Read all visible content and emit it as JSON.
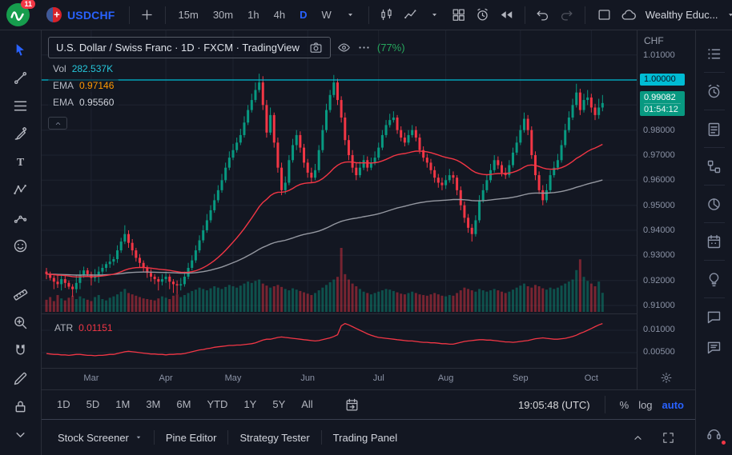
{
  "topbar": {
    "logo_badge": "11",
    "symbol": "USDCHF",
    "timeframes": [
      "15m",
      "30m",
      "1h",
      "4h",
      "D",
      "W"
    ],
    "active_timeframe": "D",
    "account": "Wealthy Educ...",
    "tool_icons": [
      "add-symbol-icon",
      "chart-style-candles-icon",
      "indicators-icon",
      "layout-templates-icon",
      "alert-icon",
      "bar-replay-icon",
      "undo-icon",
      "redo-icon",
      "select-layout-icon",
      "cloud-sync-icon",
      "caret-down-icon"
    ]
  },
  "left_toolbar": [
    "cursor-icon",
    "trend-line-icon",
    "fib-retracement-icon",
    "brush-icon",
    "text-tool-icon",
    "xabcd-pattern-icon",
    "forecast-icon",
    "emoji-icon",
    "ruler-icon",
    "zoom-in-icon",
    "magnet-icon",
    "draw-edit-icon",
    "lock-all-icon",
    "hide-drawings-icon"
  ],
  "right_sidebar": [
    "watchlist-icon",
    "alerts-icon",
    "news-icon",
    "data-window-icon",
    "hotlists-icon",
    "calendar-icon",
    "ideas-icon",
    "chat-icon",
    "streams-icon",
    "help-icon"
  ],
  "legend": {
    "title": "U.S. Dollar / Swiss Franc · 1D · FXCM · TradingView",
    "extra": "(77%)",
    "vol_label": "Vol",
    "vol_value": "282.537K",
    "ema1_label": "EMA",
    "ema1_value": "0.97146",
    "ema2_label": "EMA",
    "ema2_value": "0.95560"
  },
  "atr_pane": {
    "label": "ATR",
    "value": "0.01151",
    "tick_labels": [
      "0.01000",
      "0.00500"
    ]
  },
  "price_axis": {
    "currency": "CHF",
    "tick_labels": [
      "1.01000",
      "1.00000",
      "0.99000",
      "0.98000",
      "0.97000",
      "0.96000",
      "0.95000",
      "0.94000",
      "0.93000",
      "0.92000",
      "0.91000"
    ],
    "line_badge": "1.00000",
    "last_price_label": "0.99082",
    "countdown": "01:54:12"
  },
  "range_bar": {
    "ranges": [
      "1D",
      "5D",
      "1M",
      "3M",
      "6M",
      "YTD",
      "1Y",
      "5Y",
      "All"
    ],
    "clock": "19:05:48 (UTC)",
    "percent_label": "%",
    "log_label": "log",
    "auto_label": "auto"
  },
  "tabs_bar": {
    "tabs": [
      "Stock Screener",
      "Pine Editor",
      "Strategy Tester",
      "Trading Panel"
    ]
  },
  "colors": {
    "up": "#089981",
    "down": "#f23645",
    "volume_up": "rgba(8,153,129,0.45)",
    "volume_down": "rgba(242,54,69,0.45)",
    "ema_fast": "#f23645",
    "ema_slow": "#9598a1",
    "cyan_line": "#00bcd4",
    "atr_line": "#f23645",
    "badge_green": "#089981",
    "accent": "#2962ff",
    "grid": "#1e2330"
  },
  "chart_data": {
    "type": "candlestick",
    "symbol": "USDCHF",
    "interval": "1D",
    "title": "U.S. Dollar / Swiss Franc",
    "price_gridlines": [
      1.01,
      1.0,
      0.99,
      0.98,
      0.97,
      0.96,
      0.95,
      0.94,
      0.93,
      0.92,
      0.91
    ],
    "atr_gridlines": [
      0.01,
      0.005
    ],
    "horizontal_line": 1.0,
    "last_price": 0.99082,
    "months": [
      "Mar",
      "Apr",
      "May",
      "Jun",
      "Jul",
      "Aug",
      "Sep",
      "Oct"
    ],
    "month_indices": [
      12,
      32,
      50,
      70,
      89,
      107,
      127,
      146
    ],
    "ema_fast_period": 45,
    "ema_slow_period": 150,
    "candles": [
      [
        0.9235,
        0.925,
        0.9205,
        0.9225
      ],
      [
        0.9225,
        0.9235,
        0.92,
        0.921
      ],
      [
        0.921,
        0.922,
        0.9165,
        0.9195
      ],
      [
        0.9195,
        0.9225,
        0.917,
        0.9185
      ],
      [
        0.9185,
        0.9225,
        0.916,
        0.9205
      ],
      [
        0.9205,
        0.922,
        0.917,
        0.919
      ],
      [
        0.919,
        0.92,
        0.9165,
        0.9175
      ],
      [
        0.9175,
        0.9185,
        0.9135,
        0.9165
      ],
      [
        0.9165,
        0.922,
        0.915,
        0.919
      ],
      [
        0.919,
        0.924,
        0.9165,
        0.922
      ],
      [
        0.922,
        0.9255,
        0.921,
        0.924
      ],
      [
        0.924,
        0.925,
        0.9215,
        0.9225
      ],
      [
        0.9225,
        0.9235,
        0.918,
        0.921
      ],
      [
        0.921,
        0.9245,
        0.9195,
        0.9215
      ],
      [
        0.9215,
        0.9255,
        0.919,
        0.9235
      ],
      [
        0.9235,
        0.9265,
        0.9225,
        0.925
      ],
      [
        0.925,
        0.9275,
        0.9235,
        0.9265
      ],
      [
        0.9265,
        0.9305,
        0.925,
        0.9275
      ],
      [
        0.9275,
        0.9295,
        0.926,
        0.9285
      ],
      [
        0.9285,
        0.934,
        0.927,
        0.932
      ],
      [
        0.932,
        0.937,
        0.931,
        0.9355
      ],
      [
        0.9355,
        0.942,
        0.9345,
        0.9385
      ],
      [
        0.9385,
        0.94,
        0.933,
        0.935
      ],
      [
        0.935,
        0.9365,
        0.93,
        0.932
      ],
      [
        0.932,
        0.933,
        0.9275,
        0.929
      ],
      [
        0.929,
        0.9305,
        0.925,
        0.927
      ],
      [
        0.927,
        0.928,
        0.9235,
        0.925
      ],
      [
        0.925,
        0.926,
        0.921,
        0.923
      ],
      [
        0.923,
        0.9245,
        0.9195,
        0.9215
      ],
      [
        0.9215,
        0.9225,
        0.9185,
        0.9205
      ],
      [
        0.9205,
        0.9215,
        0.916,
        0.9195
      ],
      [
        0.9195,
        0.9225,
        0.918,
        0.9205
      ],
      [
        0.9205,
        0.9235,
        0.919,
        0.9215
      ],
      [
        0.9215,
        0.9225,
        0.9165,
        0.9195
      ],
      [
        0.9195,
        0.9205,
        0.915,
        0.9185
      ],
      [
        0.9185,
        0.92,
        0.9145,
        0.918
      ],
      [
        0.918,
        0.921,
        0.916,
        0.9185
      ],
      [
        0.9185,
        0.9235,
        0.9175,
        0.9215
      ],
      [
        0.9215,
        0.927,
        0.9205,
        0.925
      ],
      [
        0.925,
        0.93,
        0.924,
        0.928
      ],
      [
        0.928,
        0.934,
        0.927,
        0.932
      ],
      [
        0.932,
        0.938,
        0.931,
        0.936
      ],
      [
        0.936,
        0.942,
        0.935,
        0.94
      ],
      [
        0.94,
        0.9465,
        0.939,
        0.944
      ],
      [
        0.944,
        0.95,
        0.943,
        0.948
      ],
      [
        0.948,
        0.9545,
        0.947,
        0.952
      ],
      [
        0.952,
        0.958,
        0.951,
        0.956
      ],
      [
        0.956,
        0.9625,
        0.955,
        0.96
      ],
      [
        0.96,
        0.967,
        0.959,
        0.965
      ],
      [
        0.965,
        0.9715,
        0.964,
        0.969
      ],
      [
        0.969,
        0.9745,
        0.968,
        0.972
      ],
      [
        0.972,
        0.977,
        0.971,
        0.975
      ],
      [
        0.975,
        0.9805,
        0.974,
        0.978
      ],
      [
        0.978,
        0.9855,
        0.977,
        0.983
      ],
      [
        0.983,
        0.99,
        0.982,
        0.988
      ],
      [
        0.988,
        0.9945,
        0.987,
        0.992
      ],
      [
        0.992,
        0.999,
        0.991,
        0.996
      ],
      [
        0.996,
        1.0025,
        0.995,
        0.999
      ],
      [
        0.999,
        1.0015,
        0.988,
        0.99
      ],
      [
        0.99,
        0.992,
        0.977,
        0.979
      ],
      [
        0.979,
        0.989,
        0.978,
        0.986
      ],
      [
        0.986,
        0.987,
        0.973,
        0.975
      ],
      [
        0.975,
        0.977,
        0.963,
        0.965
      ],
      [
        0.965,
        0.967,
        0.954,
        0.956
      ],
      [
        0.956,
        0.9615,
        0.9545,
        0.959
      ],
      [
        0.959,
        0.97,
        0.958,
        0.968
      ],
      [
        0.968,
        0.9765,
        0.967,
        0.974
      ],
      [
        0.974,
        0.98,
        0.972,
        0.978
      ],
      [
        0.978,
        0.9795,
        0.971,
        0.973
      ],
      [
        0.973,
        0.9745,
        0.965,
        0.967
      ],
      [
        0.967,
        0.9685,
        0.961,
        0.963
      ],
      [
        0.963,
        0.965,
        0.959,
        0.961
      ],
      [
        0.961,
        0.9665,
        0.96,
        0.964
      ],
      [
        0.964,
        0.974,
        0.963,
        0.972
      ],
      [
        0.972,
        0.982,
        0.971,
        0.98
      ],
      [
        0.98,
        0.9905,
        0.979,
        0.988
      ],
      [
        0.988,
        0.996,
        0.987,
        0.994
      ],
      [
        0.994,
        1.002,
        0.993,
        0.999
      ],
      [
        0.999,
        1.0005,
        0.99,
        0.992
      ],
      [
        0.992,
        0.9935,
        0.983,
        0.985
      ],
      [
        0.985,
        0.987,
        0.974,
        0.976
      ],
      [
        0.976,
        0.978,
        0.968,
        0.97
      ],
      [
        0.97,
        0.972,
        0.963,
        0.965
      ],
      [
        0.965,
        0.967,
        0.96,
        0.962
      ],
      [
        0.962,
        0.9675,
        0.961,
        0.965
      ],
      [
        0.965,
        0.97,
        0.964,
        0.968
      ],
      [
        0.968,
        0.9695,
        0.9635,
        0.965
      ],
      [
        0.965,
        0.969,
        0.964,
        0.967
      ],
      [
        0.967,
        0.9715,
        0.966,
        0.969
      ],
      [
        0.969,
        0.975,
        0.968,
        0.973
      ],
      [
        0.973,
        0.98,
        0.972,
        0.978
      ],
      [
        0.978,
        0.984,
        0.977,
        0.982
      ],
      [
        0.982,
        0.9865,
        0.981,
        0.984
      ],
      [
        0.984,
        0.9875,
        0.983,
        0.985
      ],
      [
        0.985,
        0.986,
        0.9785,
        0.98
      ],
      [
        0.98,
        0.9815,
        0.9755,
        0.977
      ],
      [
        0.977,
        0.979,
        0.9735,
        0.975
      ],
      [
        0.975,
        0.98,
        0.974,
        0.978
      ],
      [
        0.978,
        0.982,
        0.977,
        0.98
      ],
      [
        0.98,
        0.9815,
        0.9755,
        0.977
      ],
      [
        0.977,
        0.9785,
        0.9705,
        0.972
      ],
      [
        0.972,
        0.9735,
        0.9675,
        0.969
      ],
      [
        0.969,
        0.9705,
        0.965,
        0.967
      ],
      [
        0.967,
        0.9685,
        0.9625,
        0.964
      ],
      [
        0.964,
        0.9655,
        0.959,
        0.961
      ],
      [
        0.961,
        0.9625,
        0.957,
        0.959
      ],
      [
        0.959,
        0.961,
        0.956,
        0.958
      ],
      [
        0.958,
        0.962,
        0.9565,
        0.96
      ],
      [
        0.96,
        0.9645,
        0.959,
        0.962
      ],
      [
        0.962,
        0.9635,
        0.9585,
        0.961
      ],
      [
        0.961,
        0.962,
        0.954,
        0.956
      ],
      [
        0.956,
        0.9575,
        0.948,
        0.95
      ],
      [
        0.95,
        0.9515,
        0.943,
        0.945
      ],
      [
        0.945,
        0.9465,
        0.939,
        0.941
      ],
      [
        0.941,
        0.9425,
        0.9355,
        0.9385
      ],
      [
        0.9385,
        0.946,
        0.9375,
        0.944
      ],
      [
        0.944,
        0.954,
        0.943,
        0.952
      ],
      [
        0.952,
        0.9585,
        0.951,
        0.956
      ],
      [
        0.956,
        0.962,
        0.955,
        0.96
      ],
      [
        0.96,
        0.9665,
        0.959,
        0.964
      ],
      [
        0.964,
        0.97,
        0.963,
        0.968
      ],
      [
        0.968,
        0.9695,
        0.9645,
        0.966
      ],
      [
        0.966,
        0.9675,
        0.9615,
        0.963
      ],
      [
        0.963,
        0.965,
        0.9605,
        0.962
      ],
      [
        0.962,
        0.968,
        0.961,
        0.966
      ],
      [
        0.966,
        0.973,
        0.965,
        0.971
      ],
      [
        0.971,
        0.9775,
        0.97,
        0.975
      ],
      [
        0.975,
        0.982,
        0.974,
        0.98
      ],
      [
        0.98,
        0.987,
        0.979,
        0.9845
      ],
      [
        0.9845,
        0.986,
        0.978,
        0.98
      ],
      [
        0.98,
        0.9815,
        0.9685,
        0.97
      ],
      [
        0.97,
        0.9715,
        0.96,
        0.962
      ],
      [
        0.962,
        0.9635,
        0.9545,
        0.956
      ],
      [
        0.956,
        0.958,
        0.95,
        0.952
      ],
      [
        0.952,
        0.9585,
        0.951,
        0.956
      ],
      [
        0.956,
        0.964,
        0.955,
        0.962
      ],
      [
        0.962,
        0.9675,
        0.961,
        0.965
      ],
      [
        0.965,
        0.9705,
        0.964,
        0.968
      ],
      [
        0.968,
        0.976,
        0.967,
        0.974
      ],
      [
        0.974,
        0.9825,
        0.973,
        0.98
      ],
      [
        0.98,
        0.9875,
        0.979,
        0.985
      ],
      [
        0.985,
        0.9925,
        0.984,
        0.99
      ],
      [
        0.99,
        0.9985,
        0.989,
        0.995
      ],
      [
        0.995,
        0.9965,
        0.986,
        0.988
      ],
      [
        0.988,
        0.9945,
        0.987,
        0.992
      ],
      [
        0.992,
        0.996,
        0.99,
        0.993
      ],
      [
        0.993,
        0.9945,
        0.987,
        0.989
      ],
      [
        0.989,
        0.9905,
        0.984,
        0.986
      ],
      [
        0.986,
        0.9925,
        0.9845,
        0.989
      ],
      [
        0.989,
        0.994,
        0.9875,
        0.9908
      ]
    ],
    "volumes": [
      180,
      220,
      160,
      250,
      200,
      170,
      210,
      240,
      190,
      230,
      200,
      180,
      160,
      220,
      250,
      190,
      170,
      210,
      230,
      260,
      300,
      340,
      280,
      260,
      240,
      220,
      200,
      190,
      180,
      170,
      200,
      230,
      210,
      190,
      240,
      260,
      220,
      250,
      280,
      310,
      330,
      360,
      340,
      320,
      350,
      380,
      360,
      340,
      370,
      400,
      380,
      360,
      390,
      420,
      450,
      430,
      460,
      480,
      420,
      390,
      360,
      380,
      400,
      370,
      340,
      320,
      350,
      330,
      310,
      290,
      270,
      250,
      280,
      320,
      360,
      400,
      440,
      480,
      520,
      950,
      560,
      480,
      420,
      380,
      340,
      300,
      280,
      260,
      280,
      300,
      320,
      340,
      330,
      310,
      290,
      270,
      260,
      280,
      300,
      280,
      260,
      250,
      240,
      260,
      280,
      260,
      240,
      230,
      250,
      240,
      280,
      320,
      360,
      340,
      320,
      300,
      340,
      320,
      300,
      320,
      340,
      320,
      300,
      280,
      300,
      330,
      360,
      390,
      420,
      380,
      360,
      400,
      380,
      350,
      330,
      360,
      340,
      360,
      390,
      420,
      450,
      480,
      620,
      780,
      520,
      460,
      420,
      380,
      450,
      283
    ],
    "atr": [
      0.0048,
      0.0047,
      0.0046,
      0.0046,
      0.0045,
      0.0045,
      0.0044,
      0.0045,
      0.0046,
      0.0046,
      0.0045,
      0.0044,
      0.0044,
      0.0043,
      0.0044,
      0.0044,
      0.0045,
      0.0046,
      0.0046,
      0.0048,
      0.005,
      0.0052,
      0.0053,
      0.0052,
      0.0051,
      0.005,
      0.0049,
      0.0048,
      0.0047,
      0.0047,
      0.0046,
      0.0046,
      0.0045,
      0.0046,
      0.0046,
      0.0047,
      0.0047,
      0.0048,
      0.005,
      0.0052,
      0.0054,
      0.0056,
      0.0057,
      0.0059,
      0.006,
      0.0062,
      0.0063,
      0.0064,
      0.0065,
      0.0066,
      0.0066,
      0.0067,
      0.0067,
      0.0068,
      0.0069,
      0.007,
      0.0072,
      0.0075,
      0.0078,
      0.008,
      0.008,
      0.0082,
      0.0084,
      0.0085,
      0.0084,
      0.0083,
      0.0082,
      0.0081,
      0.008,
      0.0079,
      0.0078,
      0.0077,
      0.0076,
      0.0077,
      0.0079,
      0.0081,
      0.0083,
      0.0086,
      0.009,
      0.011,
      0.0115,
      0.0112,
      0.0108,
      0.0104,
      0.01,
      0.0096,
      0.0092,
      0.0089,
      0.0086,
      0.0084,
      0.0083,
      0.0082,
      0.0081,
      0.008,
      0.0079,
      0.0078,
      0.0077,
      0.0076,
      0.0076,
      0.0075,
      0.0074,
      0.0073,
      0.0073,
      0.0072,
      0.0072,
      0.0071,
      0.007,
      0.007,
      0.0069,
      0.0069,
      0.0071,
      0.0073,
      0.0075,
      0.0076,
      0.0077,
      0.0078,
      0.0079,
      0.0079,
      0.0078,
      0.0078,
      0.0077,
      0.0076,
      0.0075,
      0.0074,
      0.0074,
      0.0073,
      0.0074,
      0.0075,
      0.0076,
      0.0077,
      0.0079,
      0.0081,
      0.0082,
      0.0083,
      0.0082,
      0.0081,
      0.008,
      0.008,
      0.0081,
      0.0082,
      0.0084,
      0.0086,
      0.0089,
      0.0093,
      0.0096,
      0.01,
      0.0104,
      0.0108,
      0.0112,
      0.0115
    ]
  }
}
